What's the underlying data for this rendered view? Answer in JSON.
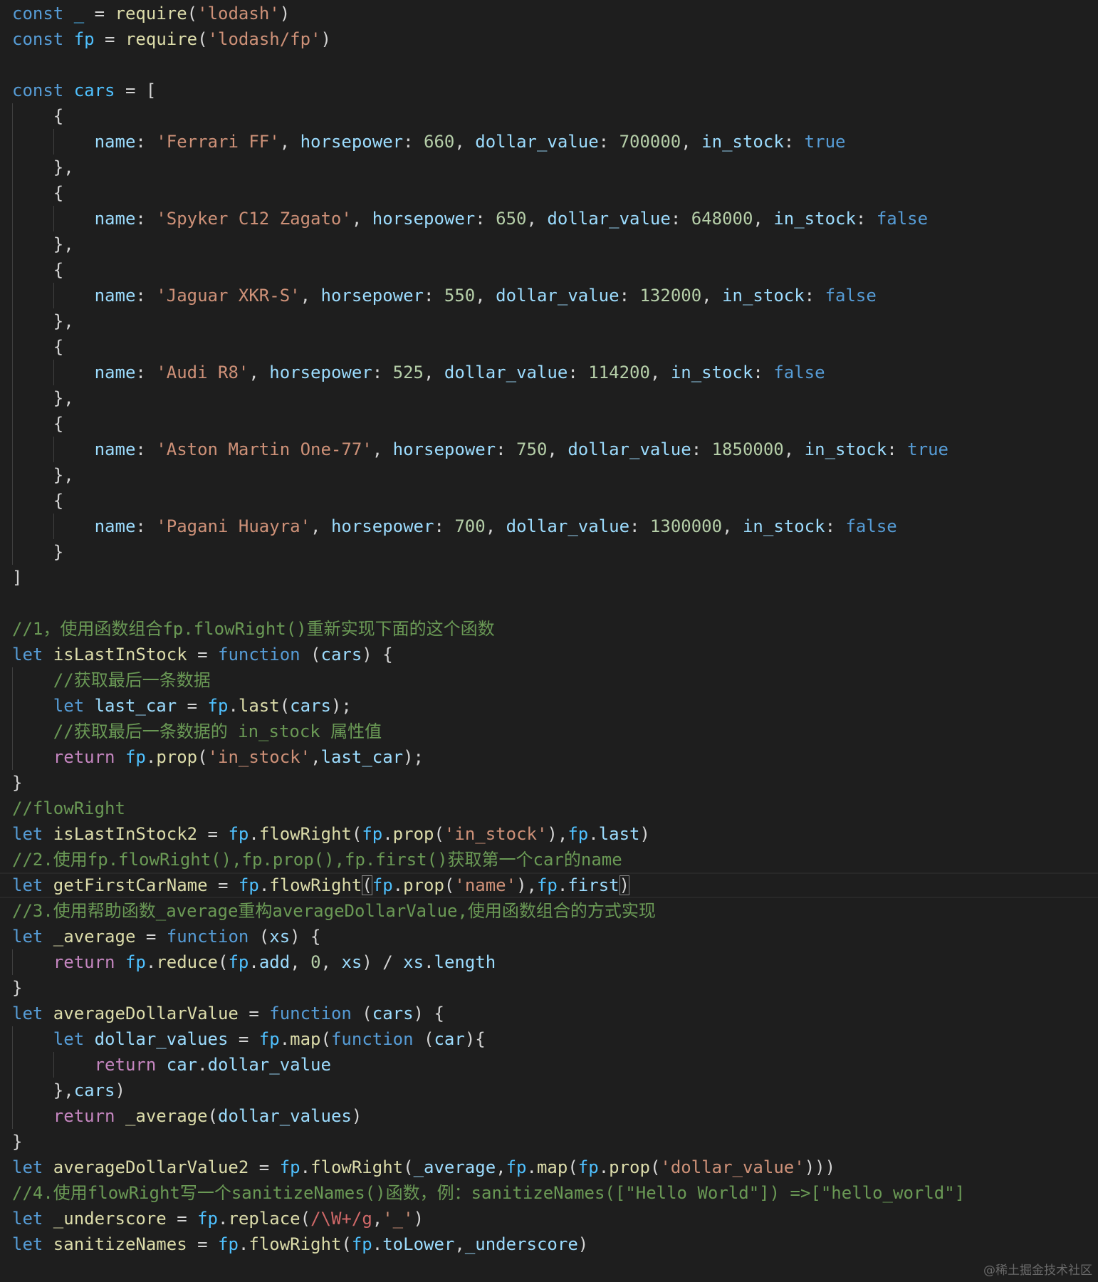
{
  "editor": {
    "current_line": 35,
    "lines": [
      [
        [
          "k",
          "const "
        ],
        [
          "c",
          "_"
        ],
        [
          "p",
          " = "
        ],
        [
          "f",
          "require"
        ],
        [
          "p",
          "("
        ],
        [
          "s",
          "'lodash'"
        ],
        [
          "p",
          ")"
        ]
      ],
      [
        [
          "k",
          "const "
        ],
        [
          "c",
          "fp"
        ],
        [
          "p",
          " = "
        ],
        [
          "f",
          "require"
        ],
        [
          "p",
          "("
        ],
        [
          "s",
          "'lodash/fp'"
        ],
        [
          "p",
          ")"
        ]
      ],
      [],
      [
        [
          "k",
          "const "
        ],
        [
          "c",
          "cars"
        ],
        [
          "p",
          " = ["
        ]
      ],
      [
        [
          "p",
          "    {"
        ]
      ],
      [
        [
          "p",
          "        "
        ],
        [
          "v",
          "name"
        ],
        [
          "p",
          ": "
        ],
        [
          "s",
          "'Ferrari FF'"
        ],
        [
          "p",
          ", "
        ],
        [
          "v",
          "horsepower"
        ],
        [
          "p",
          ": "
        ],
        [
          "n",
          "660"
        ],
        [
          "p",
          ", "
        ],
        [
          "v",
          "dollar_value"
        ],
        [
          "p",
          ": "
        ],
        [
          "n",
          "700000"
        ],
        [
          "p",
          ", "
        ],
        [
          "v",
          "in_stock"
        ],
        [
          "p",
          ": "
        ],
        [
          "k",
          "true"
        ]
      ],
      [
        [
          "p",
          "    },"
        ]
      ],
      [
        [
          "p",
          "    {"
        ]
      ],
      [
        [
          "p",
          "        "
        ],
        [
          "v",
          "name"
        ],
        [
          "p",
          ": "
        ],
        [
          "s",
          "'Spyker C12 Zagato'"
        ],
        [
          "p",
          ", "
        ],
        [
          "v",
          "horsepower"
        ],
        [
          "p",
          ": "
        ],
        [
          "n",
          "650"
        ],
        [
          "p",
          ", "
        ],
        [
          "v",
          "dollar_value"
        ],
        [
          "p",
          ": "
        ],
        [
          "n",
          "648000"
        ],
        [
          "p",
          ", "
        ],
        [
          "v",
          "in_stock"
        ],
        [
          "p",
          ": "
        ],
        [
          "k",
          "false"
        ]
      ],
      [
        [
          "p",
          "    },"
        ]
      ],
      [
        [
          "p",
          "    {"
        ]
      ],
      [
        [
          "p",
          "        "
        ],
        [
          "v",
          "name"
        ],
        [
          "p",
          ": "
        ],
        [
          "s",
          "'Jaguar XKR-S'"
        ],
        [
          "p",
          ", "
        ],
        [
          "v",
          "horsepower"
        ],
        [
          "p",
          ": "
        ],
        [
          "n",
          "550"
        ],
        [
          "p",
          ", "
        ],
        [
          "v",
          "dollar_value"
        ],
        [
          "p",
          ": "
        ],
        [
          "n",
          "132000"
        ],
        [
          "p",
          ", "
        ],
        [
          "v",
          "in_stock"
        ],
        [
          "p",
          ": "
        ],
        [
          "k",
          "false"
        ]
      ],
      [
        [
          "p",
          "    },"
        ]
      ],
      [
        [
          "p",
          "    {"
        ]
      ],
      [
        [
          "p",
          "        "
        ],
        [
          "v",
          "name"
        ],
        [
          "p",
          ": "
        ],
        [
          "s",
          "'Audi R8'"
        ],
        [
          "p",
          ", "
        ],
        [
          "v",
          "horsepower"
        ],
        [
          "p",
          ": "
        ],
        [
          "n",
          "525"
        ],
        [
          "p",
          ", "
        ],
        [
          "v",
          "dollar_value"
        ],
        [
          "p",
          ": "
        ],
        [
          "n",
          "114200"
        ],
        [
          "p",
          ", "
        ],
        [
          "v",
          "in_stock"
        ],
        [
          "p",
          ": "
        ],
        [
          "k",
          "false"
        ]
      ],
      [
        [
          "p",
          "    },"
        ]
      ],
      [
        [
          "p",
          "    {"
        ]
      ],
      [
        [
          "p",
          "        "
        ],
        [
          "v",
          "name"
        ],
        [
          "p",
          ": "
        ],
        [
          "s",
          "'Aston Martin One-77'"
        ],
        [
          "p",
          ", "
        ],
        [
          "v",
          "horsepower"
        ],
        [
          "p",
          ": "
        ],
        [
          "n",
          "750"
        ],
        [
          "p",
          ", "
        ],
        [
          "v",
          "dollar_value"
        ],
        [
          "p",
          ": "
        ],
        [
          "n",
          "1850000"
        ],
        [
          "p",
          ", "
        ],
        [
          "v",
          "in_stock"
        ],
        [
          "p",
          ": "
        ],
        [
          "k",
          "true"
        ]
      ],
      [
        [
          "p",
          "    },"
        ]
      ],
      [
        [
          "p",
          "    {"
        ]
      ],
      [
        [
          "p",
          "        "
        ],
        [
          "v",
          "name"
        ],
        [
          "p",
          ": "
        ],
        [
          "s",
          "'Pagani Huayra'"
        ],
        [
          "p",
          ", "
        ],
        [
          "v",
          "horsepower"
        ],
        [
          "p",
          ": "
        ],
        [
          "n",
          "700"
        ],
        [
          "p",
          ", "
        ],
        [
          "v",
          "dollar_value"
        ],
        [
          "p",
          ": "
        ],
        [
          "n",
          "1300000"
        ],
        [
          "p",
          ", "
        ],
        [
          "v",
          "in_stock"
        ],
        [
          "p",
          ": "
        ],
        [
          "k",
          "false"
        ]
      ],
      [
        [
          "p",
          "    }"
        ]
      ],
      [
        [
          "p",
          "]"
        ]
      ],
      [],
      [
        [
          "cm",
          "//1，使用函数组合fp.flowRight()重新实现下面的这个函数"
        ]
      ],
      [
        [
          "k",
          "let "
        ],
        [
          "f",
          "isLastInStock"
        ],
        [
          "p",
          " = "
        ],
        [
          "k",
          "function"
        ],
        [
          "p",
          " ("
        ],
        [
          "v",
          "cars"
        ],
        [
          "p",
          ") {"
        ]
      ],
      [
        [
          "p",
          "    "
        ],
        [
          "cm",
          "//获取最后一条数据"
        ]
      ],
      [
        [
          "p",
          "    "
        ],
        [
          "k",
          "let "
        ],
        [
          "v",
          "last_car"
        ],
        [
          "p",
          " = "
        ],
        [
          "c",
          "fp"
        ],
        [
          "p",
          "."
        ],
        [
          "f",
          "last"
        ],
        [
          "p",
          "("
        ],
        [
          "v",
          "cars"
        ],
        [
          "p",
          ");"
        ]
      ],
      [
        [
          "p",
          "    "
        ],
        [
          "cm",
          "//获取最后一条数据的 in_stock 属性值"
        ]
      ],
      [
        [
          "p",
          "    "
        ],
        [
          "r",
          "return "
        ],
        [
          "c",
          "fp"
        ],
        [
          "p",
          "."
        ],
        [
          "f",
          "prop"
        ],
        [
          "p",
          "("
        ],
        [
          "s",
          "'in_stock'"
        ],
        [
          "p",
          ","
        ],
        [
          "v",
          "last_car"
        ],
        [
          "p",
          ");"
        ]
      ],
      [
        [
          "p",
          "}"
        ]
      ],
      [
        [
          "cm",
          "//flowRight"
        ]
      ],
      [
        [
          "k",
          "let "
        ],
        [
          "f",
          "isLastInStock2"
        ],
        [
          "p",
          " = "
        ],
        [
          "c",
          "fp"
        ],
        [
          "p",
          "."
        ],
        [
          "f",
          "flowRight"
        ],
        [
          "p",
          "("
        ],
        [
          "c",
          "fp"
        ],
        [
          "p",
          "."
        ],
        [
          "f",
          "prop"
        ],
        [
          "p",
          "("
        ],
        [
          "s",
          "'in_stock'"
        ],
        [
          "p",
          "),"
        ],
        [
          "c",
          "fp"
        ],
        [
          "p",
          "."
        ],
        [
          "v",
          "last"
        ],
        [
          "p",
          ")"
        ]
      ],
      [
        [
          "cm",
          "//2.使用fp.flowRight(),fp.prop(),fp.first()获取第一个car的name"
        ]
      ],
      [
        [
          "k",
          "let "
        ],
        [
          "f",
          "getFirstCarName"
        ],
        [
          "p",
          " = "
        ],
        [
          "c",
          "fp"
        ],
        [
          "p",
          "."
        ],
        [
          "f",
          "flowRight"
        ],
        [
          "p bm",
          "("
        ],
        [
          "c",
          "fp"
        ],
        [
          "p",
          "."
        ],
        [
          "f",
          "prop"
        ],
        [
          "p",
          "("
        ],
        [
          "s",
          "'name'"
        ],
        [
          "p",
          "),"
        ],
        [
          "c",
          "fp"
        ],
        [
          "p",
          "."
        ],
        [
          "v",
          "first"
        ],
        [
          "p bm",
          ")"
        ]
      ],
      [
        [
          "cm",
          "//3.使用帮助函数_average重构averageDollarValue,使用函数组合的方式实现"
        ]
      ],
      [
        [
          "k",
          "let "
        ],
        [
          "f",
          "_average"
        ],
        [
          "p",
          " = "
        ],
        [
          "k",
          "function"
        ],
        [
          "p",
          " ("
        ],
        [
          "v",
          "xs"
        ],
        [
          "p",
          ") {"
        ]
      ],
      [
        [
          "p",
          "    "
        ],
        [
          "r",
          "return "
        ],
        [
          "c",
          "fp"
        ],
        [
          "p",
          "."
        ],
        [
          "f",
          "reduce"
        ],
        [
          "p",
          "("
        ],
        [
          "c",
          "fp"
        ],
        [
          "p",
          "."
        ],
        [
          "v",
          "add"
        ],
        [
          "p",
          ", "
        ],
        [
          "n",
          "0"
        ],
        [
          "p",
          ", "
        ],
        [
          "v",
          "xs"
        ],
        [
          "p",
          ") / "
        ],
        [
          "v",
          "xs"
        ],
        [
          "p",
          "."
        ],
        [
          "v",
          "length"
        ]
      ],
      [
        [
          "p",
          "}"
        ]
      ],
      [
        [
          "k",
          "let "
        ],
        [
          "f",
          "averageDollarValue"
        ],
        [
          "p",
          " = "
        ],
        [
          "k",
          "function"
        ],
        [
          "p",
          " ("
        ],
        [
          "v",
          "cars"
        ],
        [
          "p",
          ") {"
        ]
      ],
      [
        [
          "p",
          "    "
        ],
        [
          "k",
          "let "
        ],
        [
          "v",
          "dollar_values"
        ],
        [
          "p",
          " = "
        ],
        [
          "c",
          "fp"
        ],
        [
          "p",
          "."
        ],
        [
          "f",
          "map"
        ],
        [
          "p",
          "("
        ],
        [
          "k",
          "function"
        ],
        [
          "p",
          " ("
        ],
        [
          "v",
          "car"
        ],
        [
          "p",
          "){"
        ]
      ],
      [
        [
          "p",
          "        "
        ],
        [
          "r",
          "return "
        ],
        [
          "v",
          "car"
        ],
        [
          "p",
          "."
        ],
        [
          "v",
          "dollar_value"
        ]
      ],
      [
        [
          "p",
          "    },"
        ],
        [
          "v",
          "cars"
        ],
        [
          "p",
          ")"
        ]
      ],
      [
        [
          "p",
          "    "
        ],
        [
          "r",
          "return "
        ],
        [
          "f",
          "_average"
        ],
        [
          "p",
          "("
        ],
        [
          "v",
          "dollar_values"
        ],
        [
          "p",
          ")"
        ]
      ],
      [
        [
          "p",
          "}"
        ]
      ],
      [
        [
          "k",
          "let "
        ],
        [
          "f",
          "averageDollarValue2"
        ],
        [
          "p",
          " = "
        ],
        [
          "c",
          "fp"
        ],
        [
          "p",
          "."
        ],
        [
          "f",
          "flowRight"
        ],
        [
          "p",
          "("
        ],
        [
          "v",
          "_average"
        ],
        [
          "p",
          ","
        ],
        [
          "c",
          "fp"
        ],
        [
          "p",
          "."
        ],
        [
          "f",
          "map"
        ],
        [
          "p",
          "("
        ],
        [
          "c",
          "fp"
        ],
        [
          "p",
          "."
        ],
        [
          "f",
          "prop"
        ],
        [
          "p",
          "("
        ],
        [
          "s",
          "'dollar_value'"
        ],
        [
          "p",
          ")))"
        ]
      ],
      [
        [
          "cm",
          "//4.使用flowRight写一个sanitizeNames()函数，例：sanitizeNames([\"Hello World\"]) =>[\"hello_world\"]"
        ]
      ],
      [
        [
          "k",
          "let "
        ],
        [
          "f",
          "_underscore"
        ],
        [
          "p",
          " = "
        ],
        [
          "c",
          "fp"
        ],
        [
          "p",
          "."
        ],
        [
          "f",
          "replace"
        ],
        [
          "p",
          "("
        ],
        [
          "re",
          "/\\W+/g"
        ],
        [
          "p",
          ","
        ],
        [
          "s",
          "'_'"
        ],
        [
          "p",
          ")"
        ]
      ],
      [
        [
          "k",
          "let "
        ],
        [
          "f",
          "sanitizeNames"
        ],
        [
          "p",
          " = "
        ],
        [
          "c",
          "fp"
        ],
        [
          "p",
          "."
        ],
        [
          "f",
          "flowRight"
        ],
        [
          "p",
          "("
        ],
        [
          "c",
          "fp"
        ],
        [
          "p",
          "."
        ],
        [
          "v",
          "toLower"
        ],
        [
          "p",
          ","
        ],
        [
          "v",
          "_underscore"
        ],
        [
          "p",
          ")"
        ]
      ]
    ]
  },
  "watermark": "@稀土掘金技术社区",
  "colors": {
    "background": "#1e1e1e",
    "keyword": "#569cd6",
    "string": "#ce9178",
    "number": "#b5cea8",
    "comment": "#6a9955",
    "function": "#dcdcaa",
    "variable": "#9cdcfe",
    "control": "#c586c0"
  }
}
